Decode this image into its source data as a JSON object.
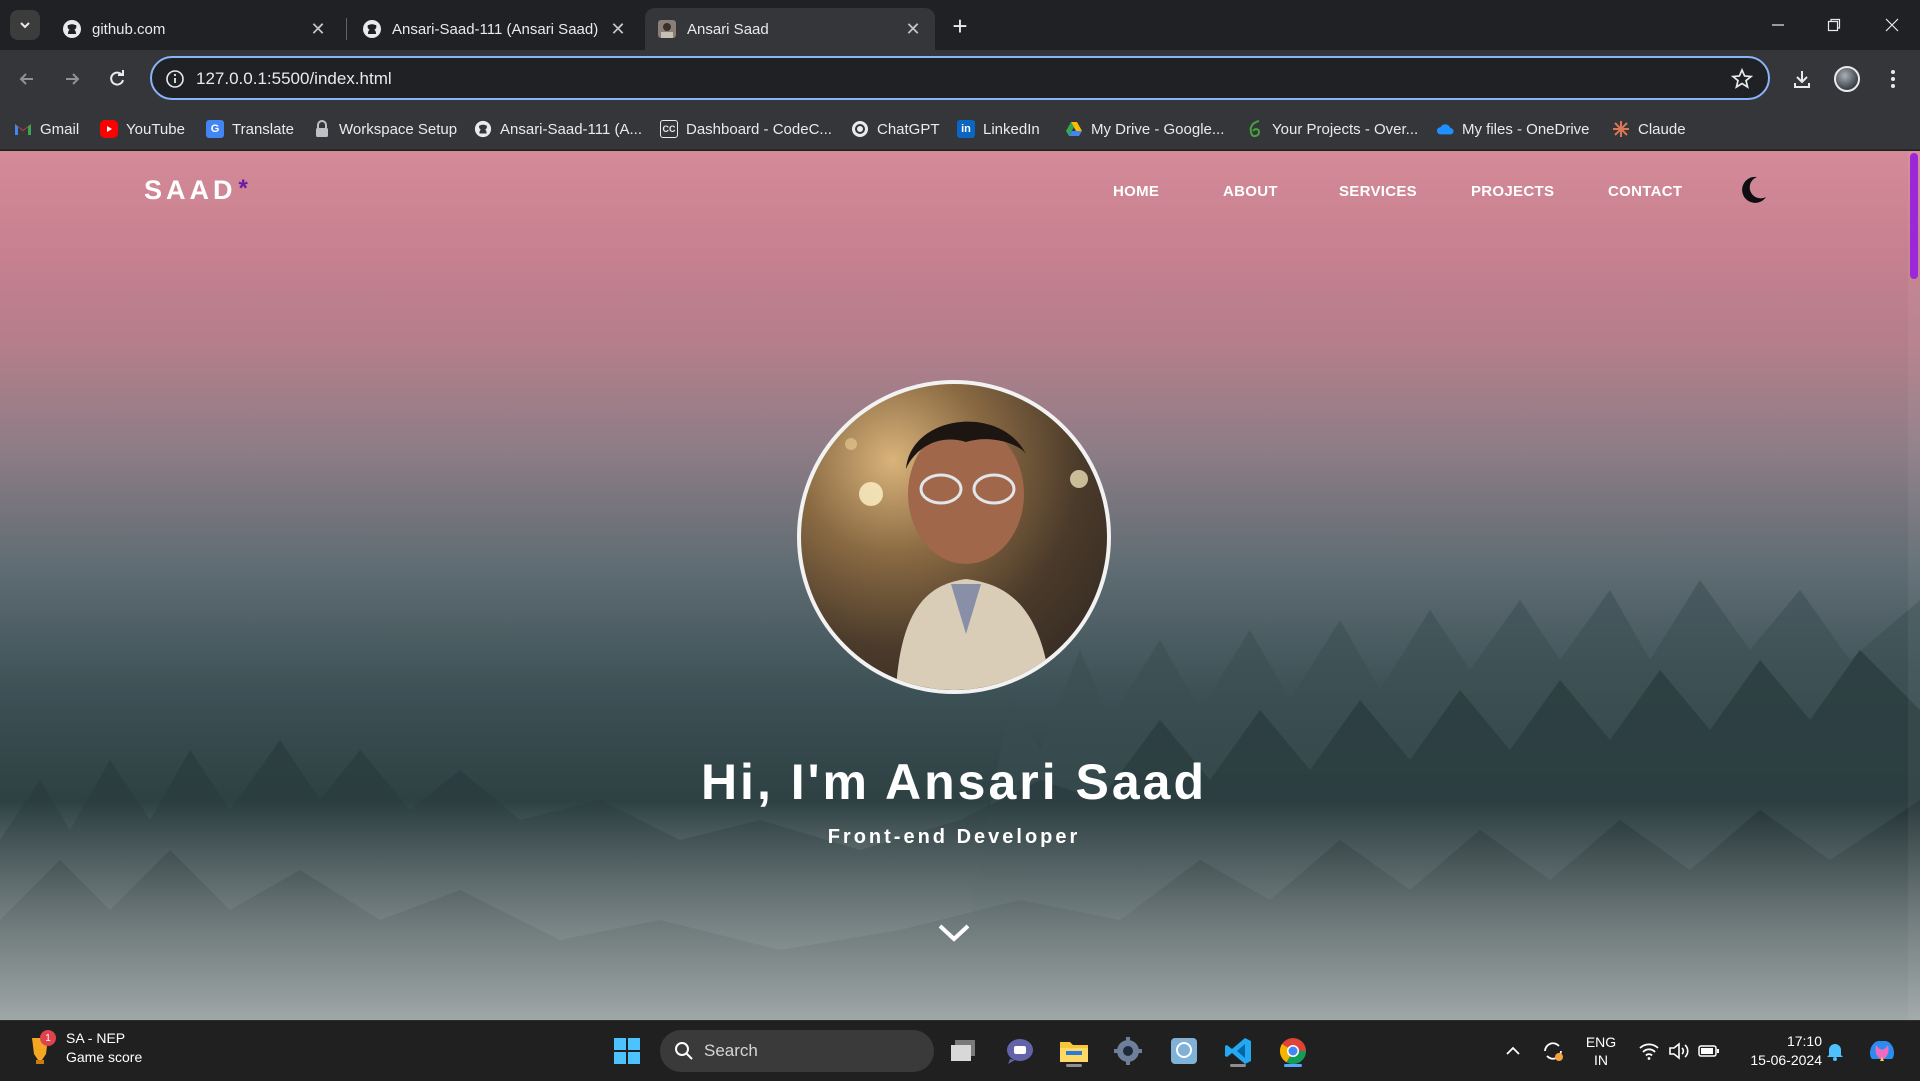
{
  "browser": {
    "tabs": [
      {
        "title": "github.com",
        "icon": "github-icon"
      },
      {
        "title": "Ansari-Saad-111 (Ansari Saad)",
        "icon": "github-icon"
      },
      {
        "title": "Ansari Saad",
        "icon": "site-favicon",
        "active": true
      }
    ],
    "address": "127.0.0.1:5500/index.html",
    "bookmarks": [
      {
        "label": "Gmail",
        "icon": "gmail-icon"
      },
      {
        "label": "YouTube",
        "icon": "youtube-icon"
      },
      {
        "label": "Translate",
        "icon": "translate-icon"
      },
      {
        "label": "Workspace Setup",
        "icon": "lock-icon"
      },
      {
        "label": "Ansari-Saad-111 (A...",
        "icon": "github-icon"
      },
      {
        "label": "Dashboard - CodeC...",
        "icon": "codechef-icon"
      },
      {
        "label": "ChatGPT",
        "icon": "chatgpt-icon"
      },
      {
        "label": "LinkedIn",
        "icon": "linkedin-icon"
      },
      {
        "label": "My Drive - Google...",
        "icon": "google-drive-icon"
      },
      {
        "label": "Your Projects - Over...",
        "icon": "overleaf-icon"
      },
      {
        "label": "My files - OneDrive",
        "icon": "onedrive-icon"
      },
      {
        "label": "Claude",
        "icon": "claude-icon"
      }
    ]
  },
  "site": {
    "logo": "SAAD",
    "logo_mark": "*",
    "nav": [
      "HOME",
      "ABOUT",
      "SERVICES",
      "PROJECTS",
      "CONTACT"
    ],
    "hero_title": "Hi, I'm Ansari Saad",
    "hero_subtitle": "Front-end Developer",
    "accent_color": "#6b1aa6"
  },
  "taskbar": {
    "widget_title": "SA - NEP",
    "widget_subtitle": "Game score",
    "widget_badge": "1",
    "search_placeholder": "Search",
    "lang_line1": "ENG",
    "lang_line2": "IN",
    "time": "17:10",
    "date": "15-06-2024"
  }
}
